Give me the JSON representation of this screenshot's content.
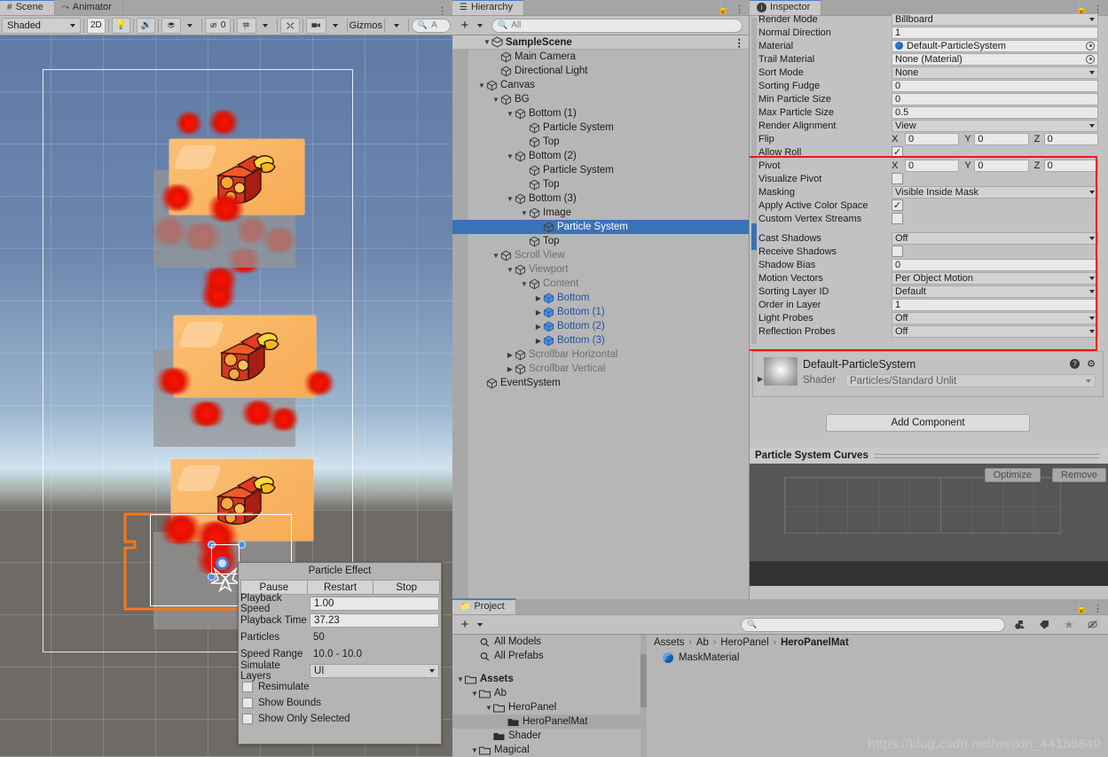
{
  "scene": {
    "tabs": [
      {
        "label": "Scene",
        "icon": "grid-icon",
        "active": true
      },
      {
        "label": "Animator",
        "icon": "animator-icon",
        "active": false
      }
    ],
    "toolbar": {
      "shading_mode": "Shaded",
      "mode_2d": "2D",
      "lighting_icon": "lightbulb-icon",
      "audio_icon": "speaker-icon",
      "fx_icon": "effects-icon",
      "hidden_count": "0",
      "grid_icon": "grid-visibility-icon",
      "tools_icon": "tools-icon",
      "camera_icon": "camera-icon",
      "gizmos_label": "Gizmos",
      "search_placeholder": "A"
    },
    "overflow_icon": "kebab-menu-icon"
  },
  "particle_effect": {
    "title": "Particle Effect",
    "buttons": [
      "Pause",
      "Restart",
      "Stop"
    ],
    "rows": [
      {
        "label": "Playback Speed",
        "value": "1.00",
        "kind": "field"
      },
      {
        "label": "Playback Time",
        "value": "37.23",
        "kind": "field"
      },
      {
        "label": "Particles",
        "value": "50",
        "kind": "text"
      },
      {
        "label": "Speed Range",
        "value": "10.0 - 10.0",
        "kind": "text"
      },
      {
        "label": "Simulate Layers",
        "value": "UI",
        "kind": "dropdown"
      }
    ],
    "checks": [
      {
        "label": "Resimulate",
        "checked": false
      },
      {
        "label": "Show Bounds",
        "checked": false
      },
      {
        "label": "Show Only Selected",
        "checked": false
      }
    ]
  },
  "hierarchy": {
    "tab": {
      "label": "Hierarchy",
      "icon": "hierarchy-icon"
    },
    "lock_icon": "lock-icon",
    "menu_icon": "kebab-menu-icon",
    "add_label": "+",
    "search_placeholder": "All",
    "scene_root": "SampleScene",
    "items": [
      {
        "label": "Main Camera",
        "depth": 2,
        "tri": "",
        "state": "normal"
      },
      {
        "label": "Directional Light",
        "depth": 2,
        "tri": "",
        "state": "normal"
      },
      {
        "label": "Canvas",
        "depth": 1,
        "tri": "v",
        "state": "normal"
      },
      {
        "label": "BG",
        "depth": 2,
        "tri": "v",
        "state": "normal"
      },
      {
        "label": "Bottom (1)",
        "depth": 3,
        "tri": "v",
        "state": "normal"
      },
      {
        "label": "Particle System",
        "depth": 4,
        "tri": "",
        "state": "normal"
      },
      {
        "label": "Top",
        "depth": 4,
        "tri": "",
        "state": "normal"
      },
      {
        "label": "Bottom (2)",
        "depth": 3,
        "tri": "v",
        "state": "normal"
      },
      {
        "label": "Particle System",
        "depth": 4,
        "tri": "",
        "state": "normal"
      },
      {
        "label": "Top",
        "depth": 4,
        "tri": "",
        "state": "normal"
      },
      {
        "label": "Bottom (3)",
        "depth": 3,
        "tri": "v",
        "state": "normal"
      },
      {
        "label": "Image",
        "depth": 4,
        "tri": "v",
        "state": "normal"
      },
      {
        "label": "Particle System",
        "depth": 5,
        "tri": "",
        "state": "selected"
      },
      {
        "label": "Top",
        "depth": 4,
        "tri": "",
        "state": "normal"
      },
      {
        "label": "Scroll View",
        "depth": 2,
        "tri": "v",
        "state": "dim"
      },
      {
        "label": "Viewport",
        "depth": 3,
        "tri": "v",
        "state": "dim"
      },
      {
        "label": "Content",
        "depth": 4,
        "tri": "v",
        "state": "dim"
      },
      {
        "label": "Bottom",
        "depth": 5,
        "tri": ">",
        "state": "prefab"
      },
      {
        "label": "Bottom (1)",
        "depth": 5,
        "tri": ">",
        "state": "prefab"
      },
      {
        "label": "Bottom (2)",
        "depth": 5,
        "tri": ">",
        "state": "prefab"
      },
      {
        "label": "Bottom (3)",
        "depth": 5,
        "tri": ">",
        "state": "prefab"
      },
      {
        "label": "Scrollbar Horizontal",
        "depth": 3,
        "tri": ">",
        "state": "dim"
      },
      {
        "label": "Scrollbar Vertical",
        "depth": 3,
        "tri": ">",
        "state": "dim"
      },
      {
        "label": "EventSystem",
        "depth": 1,
        "tri": "",
        "state": "normal"
      }
    ]
  },
  "inspector": {
    "tab": {
      "label": "Inspector",
      "icon": "info-icon"
    },
    "lock_icon": "lock-icon",
    "menu_icon": "kebab-menu-icon",
    "rows": [
      {
        "label": "Render Mode",
        "kind": "dropdown",
        "value": "Billboard"
      },
      {
        "label": "Normal Direction",
        "kind": "field",
        "value": "1"
      },
      {
        "label": "Material",
        "kind": "object",
        "value": "Default-ParticleSystem"
      },
      {
        "label": "Trail Material",
        "kind": "object",
        "value": "None (Material)"
      },
      {
        "label": "Sort Mode",
        "kind": "dropdown",
        "value": "None"
      },
      {
        "label": "Sorting Fudge",
        "kind": "field",
        "value": "0"
      },
      {
        "label": "Min Particle Size",
        "kind": "field",
        "value": "0"
      },
      {
        "label": "Max Particle Size",
        "kind": "field",
        "value": "0.5"
      },
      {
        "label": "Render Alignment",
        "kind": "dropdown",
        "value": "View"
      },
      {
        "label": "Flip",
        "kind": "xyz",
        "value": [
          "0",
          "0",
          "0"
        ]
      },
      {
        "label": "Allow Roll",
        "kind": "check",
        "value": true
      },
      {
        "label": "Pivot",
        "kind": "xyz",
        "value": [
          "0",
          "0",
          "0"
        ]
      },
      {
        "label": "Visualize Pivot",
        "kind": "check",
        "value": false
      },
      {
        "label": "Masking",
        "kind": "dropdown",
        "value": "Visible Inside Mask"
      },
      {
        "label": "Apply Active Color Space",
        "kind": "check",
        "value": true
      },
      {
        "label": "Custom Vertex Streams",
        "kind": "check",
        "value": false
      },
      {
        "label": "",
        "kind": "gap",
        "value": ""
      },
      {
        "label": "Cast Shadows",
        "kind": "dropdown",
        "value": "Off"
      },
      {
        "label": "Receive Shadows",
        "kind": "check",
        "value": false
      },
      {
        "label": "Shadow Bias",
        "kind": "field",
        "value": "0"
      },
      {
        "label": "Motion Vectors",
        "kind": "dropdown",
        "value": "Per Object Motion"
      },
      {
        "label": "Sorting Layer ID",
        "kind": "dropdown",
        "value": "Default"
      },
      {
        "label": "Order in Layer",
        "kind": "field",
        "value": "1"
      },
      {
        "label": "Light Probes",
        "kind": "dropdown",
        "value": "Off"
      },
      {
        "label": "Reflection Probes",
        "kind": "dropdown",
        "value": "Off"
      }
    ],
    "highlight_color": "#f51500",
    "material": {
      "name": "Default-ParticleSystem",
      "shader_label": "Shader",
      "shader_value": "Particles/Standard Unlit",
      "help_icon": "help-icon",
      "settings_icon": "gear-icon",
      "expand_icon": "chevron-right-icon"
    },
    "add_component_label": "Add Component",
    "curves": {
      "title": "Particle System Curves",
      "optimize_label": "Optimize",
      "remove_label": "Remove"
    }
  },
  "project": {
    "tab": {
      "label": "Project",
      "icon": "folder-icon"
    },
    "lock_icon": "lock-icon",
    "menu_icon": "kebab-menu-icon",
    "add_label": "+",
    "search_placeholder": "",
    "filter_icons": [
      "type-filter-icon",
      "label-filter-icon",
      "favorite-star-icon",
      "hidden-icon"
    ],
    "tree": [
      {
        "label": "All Models",
        "depth": 1,
        "tri": "",
        "kind": "search",
        "sel": false,
        "bold": false
      },
      {
        "label": "All Prefabs",
        "depth": 1,
        "tri": "",
        "kind": "search",
        "sel": false,
        "bold": false
      },
      {
        "label": "",
        "depth": 0,
        "tri": "",
        "kind": "gap",
        "sel": false,
        "bold": false
      },
      {
        "label": "Assets",
        "depth": 0,
        "tri": "v",
        "kind": "folder",
        "sel": false,
        "bold": true
      },
      {
        "label": "Ab",
        "depth": 1,
        "tri": "v",
        "kind": "folder",
        "sel": false,
        "bold": false
      },
      {
        "label": "HeroPanel",
        "depth": 2,
        "tri": "v",
        "kind": "folder",
        "sel": false,
        "bold": false
      },
      {
        "label": "HeroPanelMat",
        "depth": 3,
        "tri": "",
        "kind": "folder-closed",
        "sel": true,
        "bold": false
      },
      {
        "label": "Shader",
        "depth": 2,
        "tri": "",
        "kind": "folder-closed",
        "sel": false,
        "bold": false
      },
      {
        "label": "Magical",
        "depth": 1,
        "tri": "v",
        "kind": "folder",
        "sel": false,
        "bold": false
      }
    ],
    "breadcrumbs": [
      "Assets",
      "Ab",
      "HeroPanel",
      "HeroPanelMat"
    ],
    "assets": [
      {
        "label": "MaskMaterial",
        "icon": "material-sphere-icon"
      }
    ]
  },
  "watermark": "https://blog.csdn.net/weixin_44186849"
}
